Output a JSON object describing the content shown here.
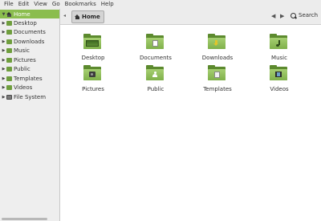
{
  "menu": [
    "File",
    "Edit",
    "View",
    "Go",
    "Bookmarks",
    "Help"
  ],
  "sidebar": {
    "items": [
      {
        "label": "Home",
        "icon": "home-icon",
        "expandable": true,
        "selected": true
      },
      {
        "label": "Desktop",
        "icon": "folder-icon",
        "expandable": true
      },
      {
        "label": "Documents",
        "icon": "folder-icon",
        "expandable": true
      },
      {
        "label": "Downloads",
        "icon": "folder-icon",
        "expandable": true
      },
      {
        "label": "Music",
        "icon": "folder-icon",
        "expandable": true
      },
      {
        "label": "Pictures",
        "icon": "folder-icon",
        "expandable": true
      },
      {
        "label": "Public",
        "icon": "folder-icon",
        "expandable": true
      },
      {
        "label": "Templates",
        "icon": "folder-icon",
        "expandable": true
      },
      {
        "label": "Videos",
        "icon": "folder-icon",
        "expandable": true
      },
      {
        "label": "File System",
        "icon": "drive-icon",
        "expandable": true
      }
    ]
  },
  "toolbar": {
    "breadcrumb_label": "Home",
    "search_label": "Search"
  },
  "main": {
    "folders": [
      {
        "label": "Desktop",
        "emblem": "desktop"
      },
      {
        "label": "Documents",
        "emblem": "documents"
      },
      {
        "label": "Downloads",
        "emblem": "downloads"
      },
      {
        "label": "Music",
        "emblem": "music"
      },
      {
        "label": "Pictures",
        "emblem": "pictures"
      },
      {
        "label": "Public",
        "emblem": "public"
      },
      {
        "label": "Templates",
        "emblem": "templates"
      },
      {
        "label": "Videos",
        "emblem": "videos"
      }
    ]
  },
  "colors": {
    "accent": "#8bbd4e",
    "folder": "#7fb04a",
    "sidebar_bg": "#eeeeee"
  }
}
